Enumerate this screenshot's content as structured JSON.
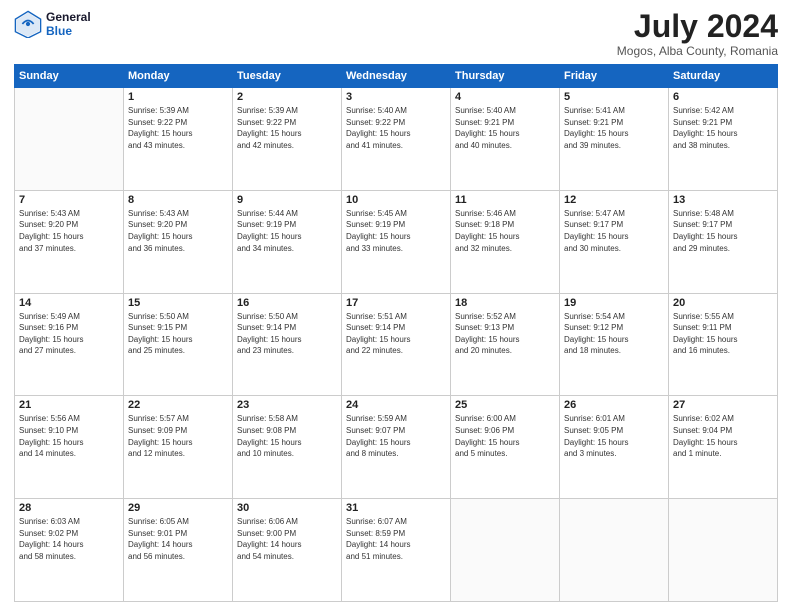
{
  "header": {
    "logo_general": "General",
    "logo_blue": "Blue",
    "month_title": "July 2024",
    "location": "Mogos, Alba County, Romania"
  },
  "calendar": {
    "days_of_week": [
      "Sunday",
      "Monday",
      "Tuesday",
      "Wednesday",
      "Thursday",
      "Friday",
      "Saturday"
    ],
    "weeks": [
      [
        {
          "day": "",
          "content": ""
        },
        {
          "day": "1",
          "content": "Sunrise: 5:39 AM\nSunset: 9:22 PM\nDaylight: 15 hours\nand 43 minutes."
        },
        {
          "day": "2",
          "content": "Sunrise: 5:39 AM\nSunset: 9:22 PM\nDaylight: 15 hours\nand 42 minutes."
        },
        {
          "day": "3",
          "content": "Sunrise: 5:40 AM\nSunset: 9:22 PM\nDaylight: 15 hours\nand 41 minutes."
        },
        {
          "day": "4",
          "content": "Sunrise: 5:40 AM\nSunset: 9:21 PM\nDaylight: 15 hours\nand 40 minutes."
        },
        {
          "day": "5",
          "content": "Sunrise: 5:41 AM\nSunset: 9:21 PM\nDaylight: 15 hours\nand 39 minutes."
        },
        {
          "day": "6",
          "content": "Sunrise: 5:42 AM\nSunset: 9:21 PM\nDaylight: 15 hours\nand 38 minutes."
        }
      ],
      [
        {
          "day": "7",
          "content": "Sunrise: 5:43 AM\nSunset: 9:20 PM\nDaylight: 15 hours\nand 37 minutes."
        },
        {
          "day": "8",
          "content": "Sunrise: 5:43 AM\nSunset: 9:20 PM\nDaylight: 15 hours\nand 36 minutes."
        },
        {
          "day": "9",
          "content": "Sunrise: 5:44 AM\nSunset: 9:19 PM\nDaylight: 15 hours\nand 34 minutes."
        },
        {
          "day": "10",
          "content": "Sunrise: 5:45 AM\nSunset: 9:19 PM\nDaylight: 15 hours\nand 33 minutes."
        },
        {
          "day": "11",
          "content": "Sunrise: 5:46 AM\nSunset: 9:18 PM\nDaylight: 15 hours\nand 32 minutes."
        },
        {
          "day": "12",
          "content": "Sunrise: 5:47 AM\nSunset: 9:17 PM\nDaylight: 15 hours\nand 30 minutes."
        },
        {
          "day": "13",
          "content": "Sunrise: 5:48 AM\nSunset: 9:17 PM\nDaylight: 15 hours\nand 29 minutes."
        }
      ],
      [
        {
          "day": "14",
          "content": "Sunrise: 5:49 AM\nSunset: 9:16 PM\nDaylight: 15 hours\nand 27 minutes."
        },
        {
          "day": "15",
          "content": "Sunrise: 5:50 AM\nSunset: 9:15 PM\nDaylight: 15 hours\nand 25 minutes."
        },
        {
          "day": "16",
          "content": "Sunrise: 5:50 AM\nSunset: 9:14 PM\nDaylight: 15 hours\nand 23 minutes."
        },
        {
          "day": "17",
          "content": "Sunrise: 5:51 AM\nSunset: 9:14 PM\nDaylight: 15 hours\nand 22 minutes."
        },
        {
          "day": "18",
          "content": "Sunrise: 5:52 AM\nSunset: 9:13 PM\nDaylight: 15 hours\nand 20 minutes."
        },
        {
          "day": "19",
          "content": "Sunrise: 5:54 AM\nSunset: 9:12 PM\nDaylight: 15 hours\nand 18 minutes."
        },
        {
          "day": "20",
          "content": "Sunrise: 5:55 AM\nSunset: 9:11 PM\nDaylight: 15 hours\nand 16 minutes."
        }
      ],
      [
        {
          "day": "21",
          "content": "Sunrise: 5:56 AM\nSunset: 9:10 PM\nDaylight: 15 hours\nand 14 minutes."
        },
        {
          "day": "22",
          "content": "Sunrise: 5:57 AM\nSunset: 9:09 PM\nDaylight: 15 hours\nand 12 minutes."
        },
        {
          "day": "23",
          "content": "Sunrise: 5:58 AM\nSunset: 9:08 PM\nDaylight: 15 hours\nand 10 minutes."
        },
        {
          "day": "24",
          "content": "Sunrise: 5:59 AM\nSunset: 9:07 PM\nDaylight: 15 hours\nand 8 minutes."
        },
        {
          "day": "25",
          "content": "Sunrise: 6:00 AM\nSunset: 9:06 PM\nDaylight: 15 hours\nand 5 minutes."
        },
        {
          "day": "26",
          "content": "Sunrise: 6:01 AM\nSunset: 9:05 PM\nDaylight: 15 hours\nand 3 minutes."
        },
        {
          "day": "27",
          "content": "Sunrise: 6:02 AM\nSunset: 9:04 PM\nDaylight: 15 hours\nand 1 minute."
        }
      ],
      [
        {
          "day": "28",
          "content": "Sunrise: 6:03 AM\nSunset: 9:02 PM\nDaylight: 14 hours\nand 58 minutes."
        },
        {
          "day": "29",
          "content": "Sunrise: 6:05 AM\nSunset: 9:01 PM\nDaylight: 14 hours\nand 56 minutes."
        },
        {
          "day": "30",
          "content": "Sunrise: 6:06 AM\nSunset: 9:00 PM\nDaylight: 14 hours\nand 54 minutes."
        },
        {
          "day": "31",
          "content": "Sunrise: 6:07 AM\nSunset: 8:59 PM\nDaylight: 14 hours\nand 51 minutes."
        },
        {
          "day": "",
          "content": ""
        },
        {
          "day": "",
          "content": ""
        },
        {
          "day": "",
          "content": ""
        }
      ]
    ]
  }
}
